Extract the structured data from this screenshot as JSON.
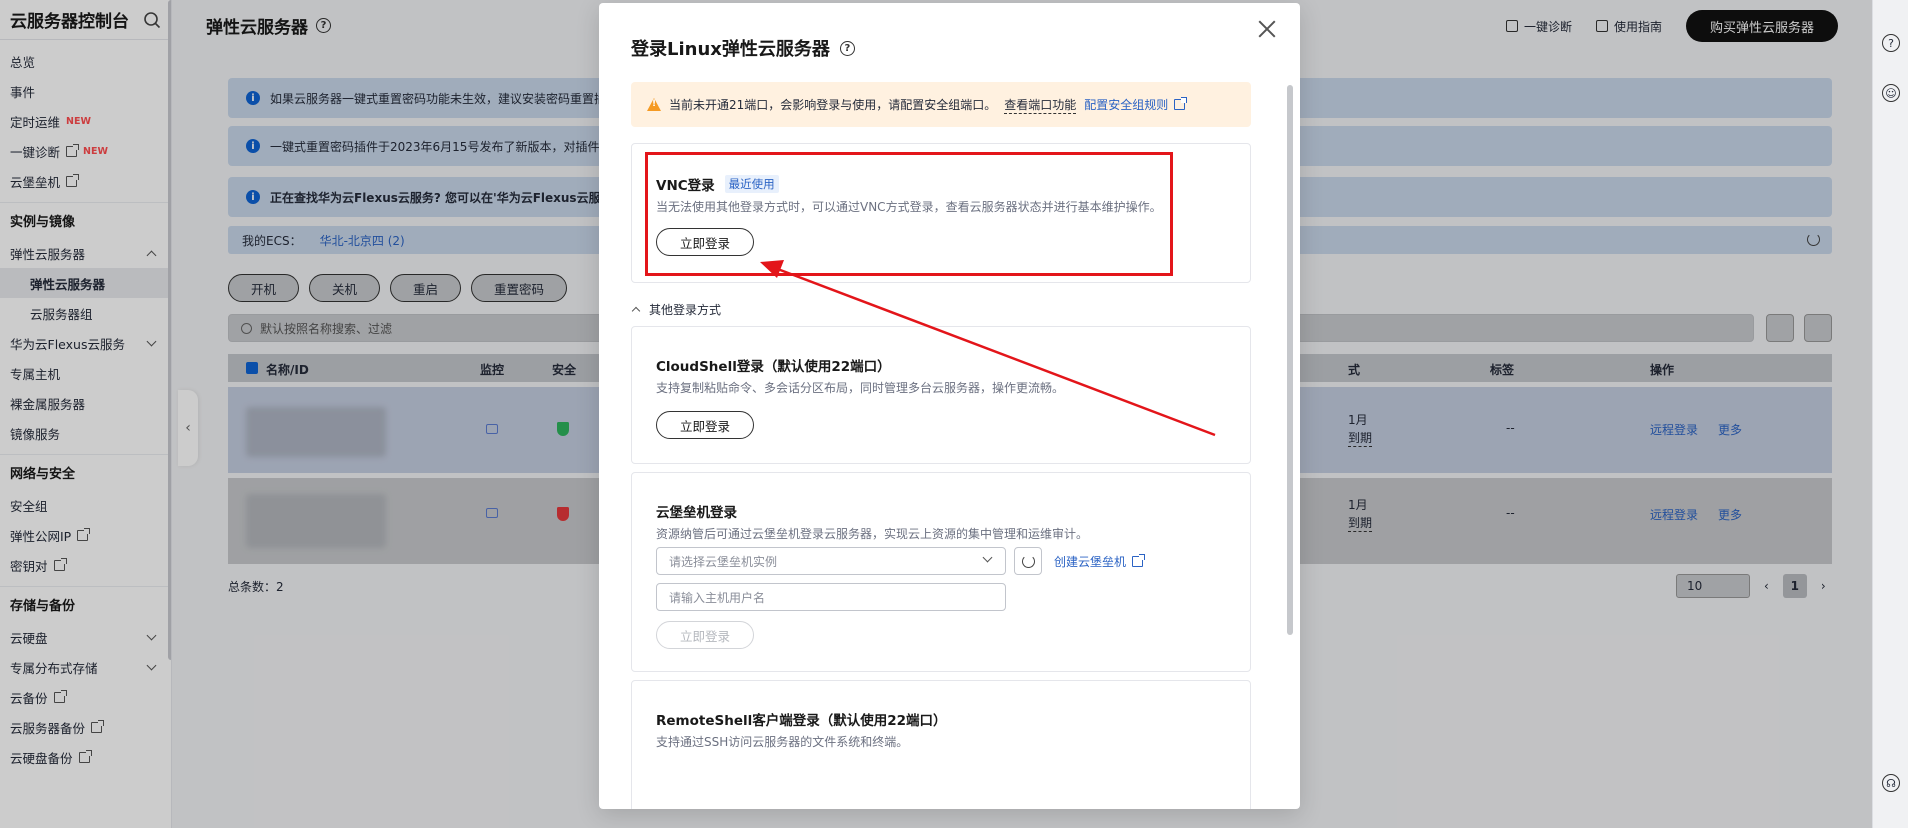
{
  "sidebar": {
    "title": "云服务器控制台",
    "items": [
      {
        "label": "总览"
      },
      {
        "label": "事件"
      },
      {
        "label": "定时运维",
        "badge": "NEW"
      },
      {
        "label": "一键诊断",
        "badge": "NEW",
        "external": true
      },
      {
        "label": "云堡垒机",
        "external": true
      }
    ],
    "group_instances": "实例与镜像",
    "instances": [
      {
        "label": "弹性云服务器",
        "expanded": true
      },
      {
        "label": "弹性云服务器",
        "sub": true,
        "active": true
      },
      {
        "label": "云服务器组",
        "sub": true
      },
      {
        "label": "华为云Flexus云服务",
        "chevron": true
      },
      {
        "label": "专属主机"
      },
      {
        "label": "裸金属服务器"
      },
      {
        "label": "镜像服务"
      }
    ],
    "group_network": "网络与安全",
    "network": [
      {
        "label": "安全组"
      },
      {
        "label": "弹性公网IP",
        "external": true
      },
      {
        "label": "密钥对",
        "external": true
      }
    ],
    "group_storage": "存储与备份",
    "storage": [
      {
        "label": "云硬盘",
        "chevron": true
      },
      {
        "label": "专属分布式存储",
        "chevron": true
      },
      {
        "label": "云备份",
        "external": true
      },
      {
        "label": "云服务器备份",
        "external": true
      },
      {
        "label": "云硬盘备份",
        "external": true
      }
    ]
  },
  "header": {
    "title": "弹性云服务器",
    "diagnose": "一键诊断",
    "guide": "使用指南",
    "buy": "购买弹性云服务器"
  },
  "banners": [
    "如果云服务器一键式重置密码功能未生效，建议安装密码重置插",
    "一键式重置密码插件于2023年6月15号发布了新版本，对插件",
    "正在查找华为云Flexus云服务? 您可以在'华为云Flexus云服务"
  ],
  "ecs": {
    "label": "我的ECS：",
    "region": "华北-北京四 (2)"
  },
  "actions": [
    "开机",
    "关机",
    "重启",
    "重置密码"
  ],
  "search": {
    "placeholder": "默认按照名称搜索、过滤"
  },
  "table": {
    "columns": {
      "name": "名称/ID",
      "monitor": "监控",
      "security": "安全",
      "billing": "式",
      "tags": "标签",
      "ops": "操作"
    },
    "rows": [
      {
        "billing_line1": "1月",
        "billing_line2": "到期",
        "tags": "--",
        "remote": "远程登录",
        "more": "更多",
        "security_color": "#2db35d"
      },
      {
        "billing_line1": "1月",
        "billing_line2": "到期",
        "tags": "--",
        "remote": "远程登录",
        "more": "更多",
        "security_color": "#e5383b"
      }
    ],
    "total": "总条数：2",
    "page_size": "10",
    "page": "1"
  },
  "modal": {
    "title": "登录Linux弹性云服务器",
    "warning": {
      "text": "当前未开通21端口，会影响登录与使用，请配置安全组端口。",
      "link1": "查看端口功能",
      "link2": "配置安全组规则"
    },
    "vnc": {
      "title": "VNC登录",
      "tag": "最近使用",
      "desc": "当无法使用其他登录方式时，可以通过VNC方式登录，查看云服务器状态并进行基本维护操作。",
      "button": "立即登录"
    },
    "other_ways": "其他登录方式",
    "cloudshell": {
      "title": "CloudShell登录（默认使用22端口）",
      "desc": "支持复制粘贴命令、多会话分区布局，同时管理多台云服务器，操作更流畅。",
      "button": "立即登录"
    },
    "bastion": {
      "title": "云堡垒机登录",
      "desc": "资源纳管后可通过云堡垒机登录云服务器，实现云上资源的集中管理和运维审计。",
      "select_placeholder": "请选择云堡垒机实例",
      "create_link": "创建云堡垒机",
      "input_placeholder": "请输入主机用户名",
      "button": "立即登录"
    },
    "remoteshell": {
      "title": "RemoteShell客户端登录（默认使用22端口）",
      "desc": "支持通过SSH访问云服务器的文件系统和终端。"
    }
  },
  "colors": {
    "accent": "#2b63c4",
    "annotation": "#e3151a",
    "warning_bg": "#fff1e0"
  }
}
